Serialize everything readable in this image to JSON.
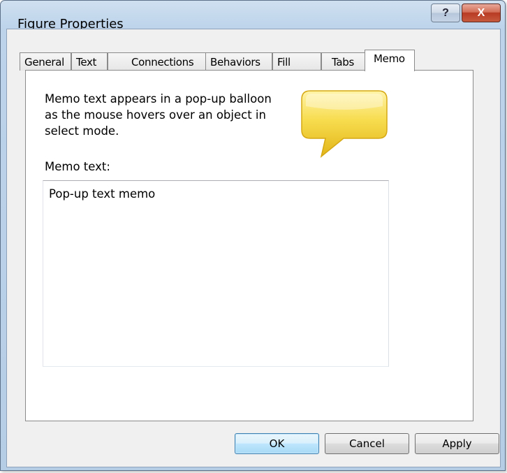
{
  "window": {
    "title": "Figure Properties",
    "help_label": "?",
    "close_label": "X"
  },
  "tabs": [
    {
      "label": "General",
      "active": false
    },
    {
      "label": "Text",
      "active": false
    },
    {
      "label": "Connections",
      "active": false
    },
    {
      "label": "Behaviors",
      "active": false
    },
    {
      "label": "Fill",
      "active": false
    },
    {
      "label": "Tabs",
      "active": false
    },
    {
      "label": "Memo",
      "active": true
    }
  ],
  "memo": {
    "description_lines": [
      "Memo text appears in a pop-up balloon",
      "as the mouse hovers over an object in",
      "select mode."
    ],
    "field_label": "Memo text:",
    "field_value": "Pop-up text memo",
    "balloon_icon": "speech-balloon-icon",
    "balloon_color": "#f5d33a"
  },
  "buttons": {
    "ok": "OK",
    "cancel": "Cancel",
    "apply": "Apply"
  }
}
